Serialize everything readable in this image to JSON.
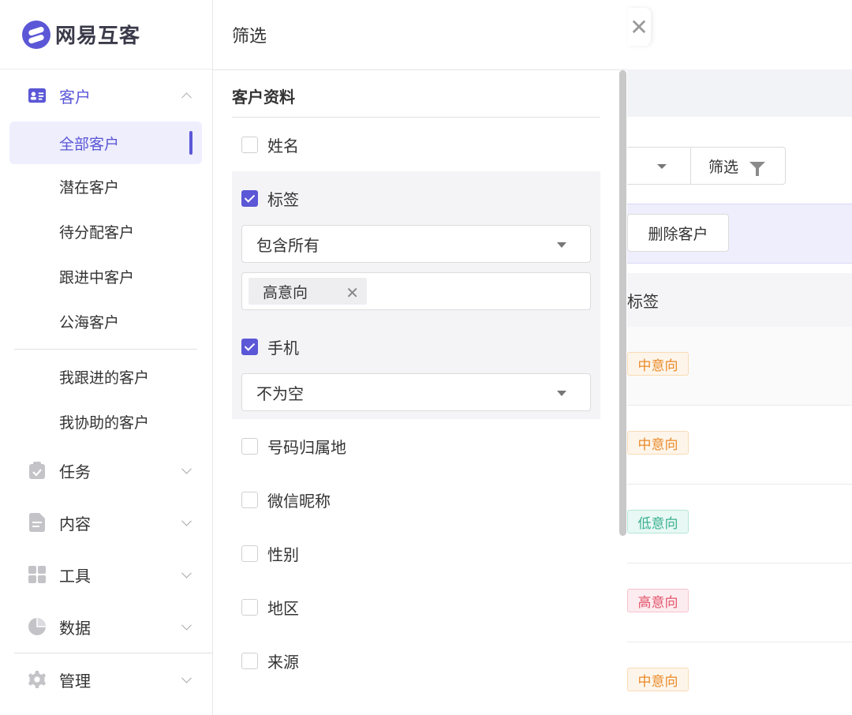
{
  "app": {
    "name": "网易互客"
  },
  "sidebar": {
    "groups": [
      {
        "label": "客户",
        "icon": "contact-card-icon",
        "expanded": true
      },
      {
        "label": "任务",
        "icon": "clipboard-icon"
      },
      {
        "label": "内容",
        "icon": "document-icon"
      },
      {
        "label": "工具",
        "icon": "grid-icon"
      },
      {
        "label": "数据",
        "icon": "pie-chart-icon"
      },
      {
        "label": "管理",
        "icon": "gear-icon"
      }
    ],
    "customer_items": [
      {
        "label": "全部客户",
        "active": true
      },
      {
        "label": "潜在客户"
      },
      {
        "label": "待分配客户"
      },
      {
        "label": "跟进中客户"
      },
      {
        "label": "公海客户"
      }
    ],
    "my_items": [
      {
        "label": "我跟进的客户"
      },
      {
        "label": "我协助的客户"
      }
    ]
  },
  "drawer": {
    "title": "筛选",
    "section_title": "客户资料",
    "fields": [
      {
        "label": "姓名",
        "checked": false
      },
      {
        "label": "标签",
        "checked": true,
        "select_value": "包含所有",
        "tags": [
          "高意向"
        ]
      },
      {
        "label": "手机",
        "checked": true,
        "select_value": "不为空"
      },
      {
        "label": "号码归属地",
        "checked": false
      },
      {
        "label": "微信昵称",
        "checked": false
      },
      {
        "label": "性别",
        "checked": false
      },
      {
        "label": "地区",
        "checked": false
      },
      {
        "label": "来源",
        "checked": false
      }
    ]
  },
  "background": {
    "filter_button": "筛选",
    "delete_button": "删除客户",
    "column_tag": "标签",
    "row_tags": [
      "中意向",
      "中意向",
      "低意向",
      "高意向",
      "中意向"
    ],
    "tag_colors": {
      "高意向": "#e2546b",
      "中意向": "#e98a2a",
      "低意向": "#3bb191"
    }
  },
  "colors": {
    "accent": "#5b57d6"
  }
}
